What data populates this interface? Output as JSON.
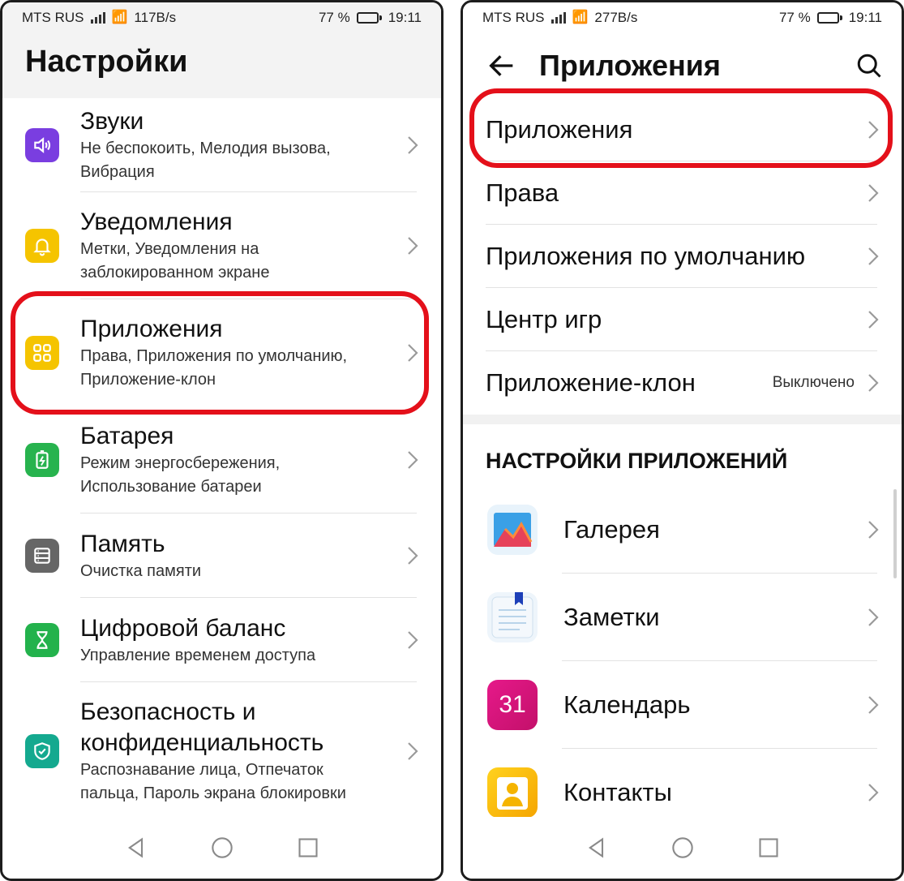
{
  "status_left": {
    "carrier": "MTS RUS",
    "speed": "117B/s",
    "battery": "77 %",
    "time": "19:11"
  },
  "status_right": {
    "carrier": "MTS RUS",
    "speed": "277B/s",
    "battery": "77 %",
    "time": "19:11"
  },
  "left": {
    "title": "Настройки",
    "items": [
      {
        "title": "Звуки",
        "subtitle": "Не беспокоить, Мелодия вызова, Вибрация",
        "icon": "sound-icon",
        "color": "#7a3ee0"
      },
      {
        "title": "Уведомления",
        "subtitle": "Метки, Уведомления на заблокированном экране",
        "icon": "bell-icon",
        "color": "#f5c400"
      },
      {
        "title": "Приложения",
        "subtitle": "Права, Приложения по умолчанию, Приложение-клон",
        "icon": "apps-grid-icon",
        "color": "#f5c400"
      },
      {
        "title": "Батарея",
        "subtitle": "Режим энергосбережения, Использование батареи",
        "icon": "battery-icon",
        "color": "#27b34e"
      },
      {
        "title": "Память",
        "subtitle": "Очистка памяти",
        "icon": "storage-icon",
        "color": "#666666"
      },
      {
        "title": "Цифровой баланс",
        "subtitle": "Управление временем доступа",
        "icon": "hourglass-icon",
        "color": "#23b24c"
      },
      {
        "title": "Безопасность и конфиденциальность",
        "subtitle": "Распознавание лица, Отпечаток пальца, Пароль экрана блокировки",
        "icon": "shield-icon",
        "color": "#14a98f"
      }
    ]
  },
  "right": {
    "title": "Приложения",
    "items": [
      {
        "title": "Приложения"
      },
      {
        "title": "Права"
      },
      {
        "title": "Приложения по умолчанию"
      },
      {
        "title": "Центр игр"
      },
      {
        "title": "Приложение-клон",
        "value": "Выключено"
      }
    ],
    "section_title": "НАСТРОЙКИ ПРИЛОЖЕНИЙ",
    "apps": [
      {
        "title": "Галерея",
        "icon": "gallery-icon"
      },
      {
        "title": "Заметки",
        "icon": "notes-icon"
      },
      {
        "title": "Календарь",
        "icon": "calendar-icon",
        "icon_text": "31"
      },
      {
        "title": "Контакты",
        "icon": "contacts-icon"
      }
    ]
  },
  "colors": {
    "highlight": "#e4101a"
  }
}
